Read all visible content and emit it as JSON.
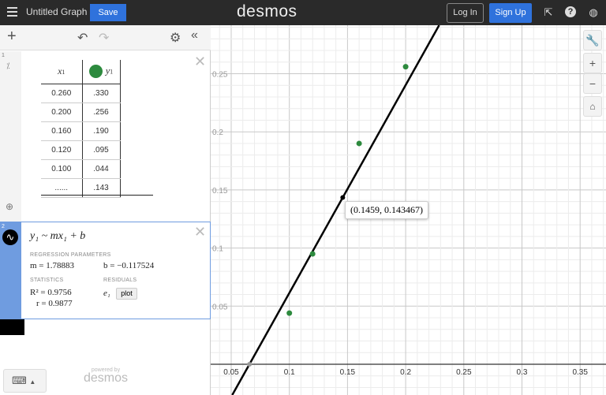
{
  "topbar": {
    "title": "Untitled Graph",
    "save": "Save",
    "logo": "desmos",
    "login": "Log In",
    "signup": "Sign Up"
  },
  "table": {
    "index": "1",
    "headers": [
      "x1",
      "y1"
    ],
    "x_label": "x",
    "y_label": "y",
    "sub": "1",
    "rows": [
      [
        "0.260",
        ".330"
      ],
      [
        "0.200",
        ".256"
      ],
      [
        "0.160",
        ".190"
      ],
      [
        "0.120",
        ".095"
      ],
      [
        "0.100",
        ".044"
      ],
      [
        "......",
        ".143"
      ]
    ]
  },
  "regression": {
    "index": "2",
    "formula": "y₁ ~ mx₁ + b",
    "params_label": "REGRESSION PARAMETERS",
    "m": "m = 1.78883",
    "b": "b = −0.117524",
    "stats_label": "STATISTICS",
    "residuals_label": "RESIDUALS",
    "r2": "R² = 0.9756",
    "r": "r = 0.9877",
    "resid": "e₁",
    "plot": "plot"
  },
  "footer": {
    "powered": "powered by",
    "brand": "desmos"
  },
  "graph": {
    "tooltip": "(0.1459, 0.143467)",
    "accent": "#2d8a3e"
  },
  "chart_data": {
    "type": "scatter",
    "xlim": [
      -0.035,
      0.305
    ],
    "ylim": [
      -0.026,
      0.292
    ],
    "x_ticks": [
      "0.05",
      "0.1",
      "0.15",
      "0.2",
      "0.25",
      "0.3",
      "0.35"
    ],
    "y_ticks": [
      "0.05",
      "0.1",
      "0.15",
      "0.2",
      "0.25"
    ],
    "points": [
      [
        0.26,
        0.33
      ],
      [
        0.2,
        0.256
      ],
      [
        0.16,
        0.19
      ],
      [
        0.12,
        0.095
      ],
      [
        0.1,
        0.044
      ]
    ],
    "line": {
      "m": 1.78883,
      "b": -0.117524
    },
    "highlight": [
      0.1459,
      0.143467
    ]
  }
}
